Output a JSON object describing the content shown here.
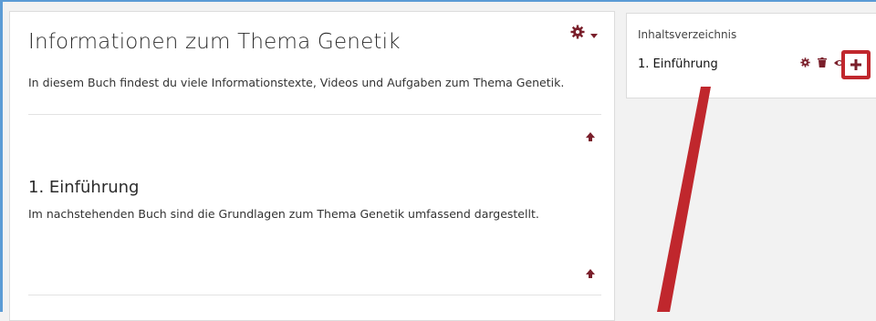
{
  "main": {
    "title": "Informationen zum Thema Genetik",
    "intro": "In diesem Buch findest du viele Informationstexte, Videos und Aufgaben zum Thema Genetik.",
    "sections": [
      {
        "heading": "1. Einführung",
        "text": "Im nachstehenden Buch sind die Grundlagen zum Thema Genetik umfassend dargestellt."
      }
    ]
  },
  "toc": {
    "heading": "Inhaltsverzeichnis",
    "items": [
      {
        "label": "1. Einführung"
      }
    ]
  },
  "icons": {
    "settings": "gear-icon",
    "dropdown": "caret-down-icon",
    "top": "arrow-up-icon",
    "delete": "trash-icon",
    "visibility": "eye-icon",
    "add": "plus-icon"
  },
  "colors": {
    "icon_accent": "#7a1f2b",
    "annotation": "#c0272d",
    "frame": "#5b9bd5"
  }
}
